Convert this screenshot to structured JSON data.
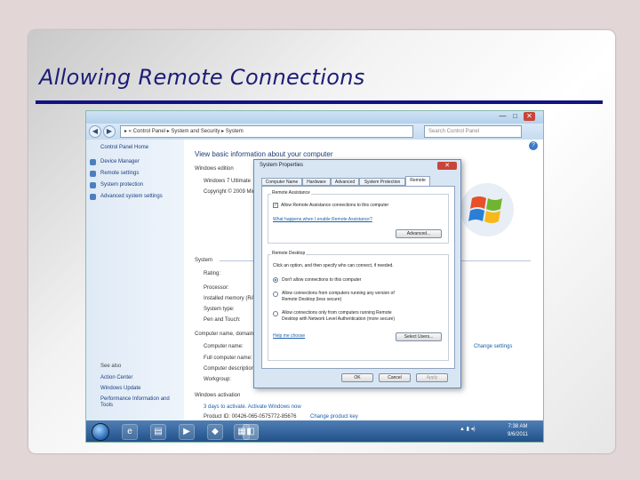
{
  "slide": {
    "title": "Allowing Remote Connections"
  },
  "window": {
    "controls": {
      "minimize": "—",
      "maximize": "□",
      "close": "✕"
    },
    "nav": {
      "back": "◀",
      "forward": "▶"
    },
    "address": "▸ « Control Panel ▸ System and Security ▸ System",
    "search_placeholder": "Search Control Panel",
    "help": "?"
  },
  "sidebar": {
    "home": "Control Panel Home",
    "links": [
      "Device Manager",
      "Remote settings",
      "System protection",
      "Advanced system settings"
    ],
    "see_also_label": "See also",
    "see_also": [
      "Action Center",
      "Windows Update",
      "Performance Information and Tools"
    ]
  },
  "main": {
    "heading": "View basic information about your computer",
    "edition_label": "Windows edition",
    "edition_lines": [
      "Windows 7 Ultimate",
      "Copyright © 2009 Microsoft Corporation."
    ],
    "system_label": "System",
    "system_rows": [
      "Rating:",
      "Processor:",
      "Installed memory (RAM):",
      "System type:",
      "Pen and Touch:"
    ],
    "computer_label": "Computer name, domain, and workgroup settings",
    "computer_rows": [
      "Computer name:",
      "Full computer name:",
      "Computer description:",
      "Workgroup:"
    ],
    "activation_label": "Windows activation",
    "activation_text": "3 days to activate. Activate Windows now",
    "product_id": "Product ID: 00426-065-0575772-85676",
    "change_key": "Change product key",
    "change_settings": "Change settings"
  },
  "dialog": {
    "title": "System Properties",
    "close": "✕",
    "tabs": [
      "Computer Name",
      "Hardware",
      "Advanced",
      "System Protection",
      "Remote"
    ],
    "active_tab": "Remote",
    "remote_assistance": {
      "label": "Remote Assistance",
      "checkbox": "Allow Remote Assistance connections to this computer",
      "checked": true,
      "link": "What happens when I enable Remote Assistance?",
      "advanced_button": "Advanced..."
    },
    "remote_desktop": {
      "label": "Remote Desktop",
      "instructions": "Click an option, and then specify who can connect, if needed.",
      "options": [
        "Don't allow connections to this computer",
        "Allow connections from computers running any version of",
        "Remote Desktop (less secure)",
        "Allow connections only from computers running Remote",
        "Desktop with Network Level Authentication (more secure)"
      ],
      "selected": 0,
      "help_link": "Help me choose",
      "select_users_button": "Select Users..."
    },
    "buttons": {
      "ok": "OK",
      "cancel": "Cancel",
      "apply": "Apply"
    }
  },
  "taskbar": {
    "icons": [
      "e",
      "▤",
      "▶",
      "◆",
      "▦",
      "◧"
    ],
    "tray": "▲ ▮ ◂)",
    "time": "7:38 AM",
    "date": "9/6/2011"
  },
  "colors": {
    "title": "#1c1c78",
    "rule": "#121282",
    "accent": "#1a5faa"
  }
}
